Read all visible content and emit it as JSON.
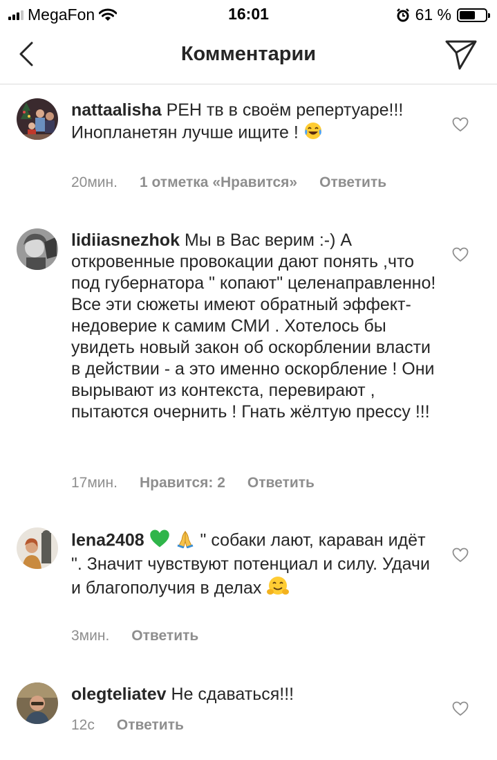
{
  "status_bar": {
    "carrier": "MegaFon",
    "time": "16:01",
    "battery_percent_label": "61 %",
    "battery_level": 0.61
  },
  "nav": {
    "title": "Комментарии",
    "back_icon": "chevron-left-icon",
    "send_icon": "paper-plane-icon"
  },
  "comments": [
    {
      "username": "nattaalisha",
      "text": "РЕН тв в своём репертуаре!!! Инопланетян лучше ищите !",
      "emoji": [
        "joy-emoji"
      ],
      "time": "20мин.",
      "likes": "1 отметка «Нравится»",
      "reply": "Ответить"
    },
    {
      "username": "lidiiasnezhok",
      "text": "Мы в Вас верим :-) А откровенные провокации дают понять ,что под губернатора \" копают\" целенаправленно! Все эти сюжеты имеют обратный эффект- недоверие к самим СМИ . Хотелось бы увидеть новый закон об оскорблении власти в действии - а это именно оскорбление ! Они вырывают из контекста, перевирают , пытаются очернить ! Гнать жёлтую прессу !!!",
      "time": "17мин.",
      "likes": "Нравится: 2",
      "reply": "Ответить"
    },
    {
      "username": "lena2408",
      "emoji_lead": [
        "green-heart-emoji",
        "folded-hands-emoji"
      ],
      "text": "\" собаки лают, караван идёт \". Значит чувствуют потенциал и силу. Удачи и благополучия в делах",
      "emoji": [
        "hugging-face-emoji"
      ],
      "time": "3мин.",
      "reply": "Ответить"
    },
    {
      "username": "olegteliatev",
      "text": "Не сдаваться!!!",
      "time": "12с",
      "reply": "Ответить"
    }
  ],
  "colors": {
    "text": "#262626",
    "meta": "#8e8e8e",
    "divider": "#dbdbdb",
    "green_heart": "#2fb54a"
  }
}
